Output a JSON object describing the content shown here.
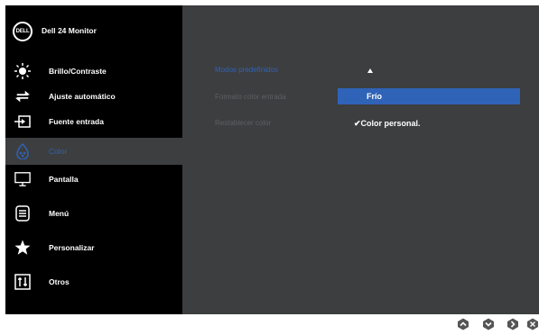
{
  "header": {
    "logo_text": "DELL",
    "title": "Dell 24 Monitor"
  },
  "sidebar": {
    "items": [
      {
        "label": "Brillo/Contraste",
        "icon": "brightness-icon"
      },
      {
        "label": "Ajuste automático",
        "icon": "auto-adjust-icon"
      },
      {
        "label": "Fuente entrada",
        "icon": "input-source-icon"
      },
      {
        "label": "Color",
        "icon": "color-palette-icon",
        "active": true
      },
      {
        "label": "Pantalla",
        "icon": "display-icon"
      },
      {
        "label": "Menú",
        "icon": "menu-icon"
      },
      {
        "label": "Personalizar",
        "icon": "star-icon"
      },
      {
        "label": "Otros",
        "icon": "other-settings-icon"
      }
    ]
  },
  "main": {
    "options": [
      {
        "label": "Modos predefinidos",
        "active": true
      },
      {
        "label": "Formato color entrada"
      },
      {
        "label": "Restablecer color"
      }
    ],
    "preset_value": "Frío",
    "selected_value": "✔Color personal."
  },
  "buttons": [
    {
      "icon": "up-button-icon"
    },
    {
      "icon": "down-button-icon"
    },
    {
      "icon": "enter-button-icon"
    },
    {
      "icon": "exit-button-icon"
    }
  ],
  "colors": {
    "accent": "#2f63b8",
    "panel": "#3d3e40",
    "sidebar": "#000000",
    "inactive_text": "#5e5f62"
  }
}
